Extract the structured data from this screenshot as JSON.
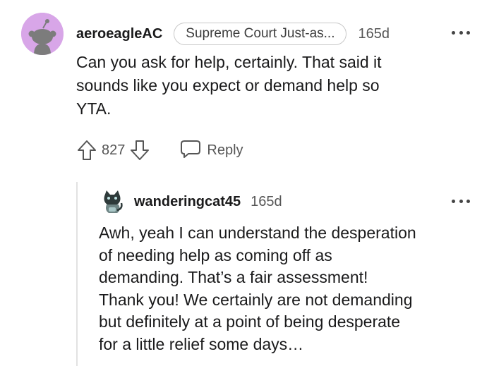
{
  "comment": {
    "username": "aeroeagleAC",
    "flair": "Supreme Court Just-as...",
    "age": "165d",
    "more_icon": "more-horizontal-icon",
    "lines": [
      "Can you ask for help, certainly. That said it",
      "sounds like you expect or demand help so",
      "YTA."
    ],
    "score": "827",
    "reply_label": "Reply",
    "avatar_color": "#d8a6e8"
  },
  "reply": {
    "username": "wanderingcat45",
    "age": "165d",
    "more_icon": "more-horizontal-icon",
    "lines": [
      "Awh, yeah I can understand the desperation",
      "of needing help as coming off as",
      "demanding. That’s a fair assessment!",
      "Thank you! We certainly are not demanding",
      "but definitely at a point of being desperate",
      "for a little relief some days…"
    ]
  }
}
